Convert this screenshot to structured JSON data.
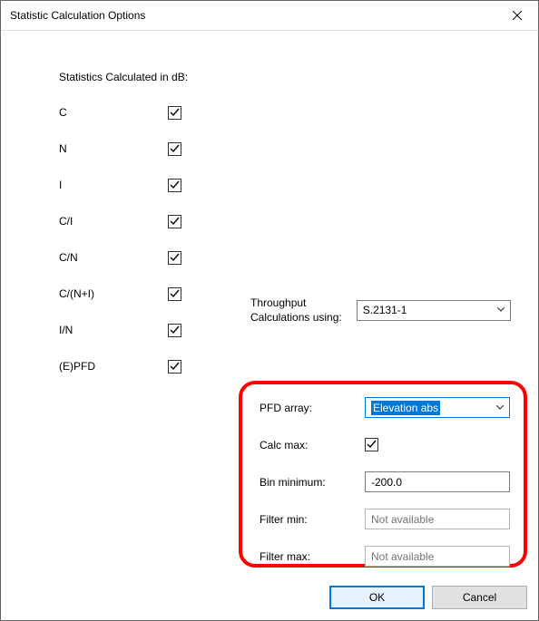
{
  "window": {
    "title": "Statistic Calculation Options"
  },
  "section": {
    "heading": "Statistics Calculated in dB:"
  },
  "stats": [
    {
      "label": "C",
      "checked": true
    },
    {
      "label": "N",
      "checked": true
    },
    {
      "label": "I",
      "checked": true
    },
    {
      "label": "C/I",
      "checked": true
    },
    {
      "label": "C/N",
      "checked": true
    },
    {
      "label": "C/(N+I)",
      "checked": true
    },
    {
      "label": "I/N",
      "checked": true
    },
    {
      "label": "(E)PFD",
      "checked": true
    }
  ],
  "throughput": {
    "label_line1": "Throughput",
    "label_line2": "Calculations using:",
    "value": "S.2131-1"
  },
  "pfd": {
    "array_label": "PFD array:",
    "array_value": "Elevation abs",
    "calc_max_label": "Calc max:",
    "calc_max_checked": true,
    "bin_min_label": "Bin minimum:",
    "bin_min_value": "-200.0",
    "filter_min_label": "Filter min:",
    "filter_min_placeholder": "Not available",
    "filter_max_label": "Filter max:",
    "filter_max_placeholder": "Not available"
  },
  "buttons": {
    "ok": "OK",
    "cancel": "Cancel"
  }
}
